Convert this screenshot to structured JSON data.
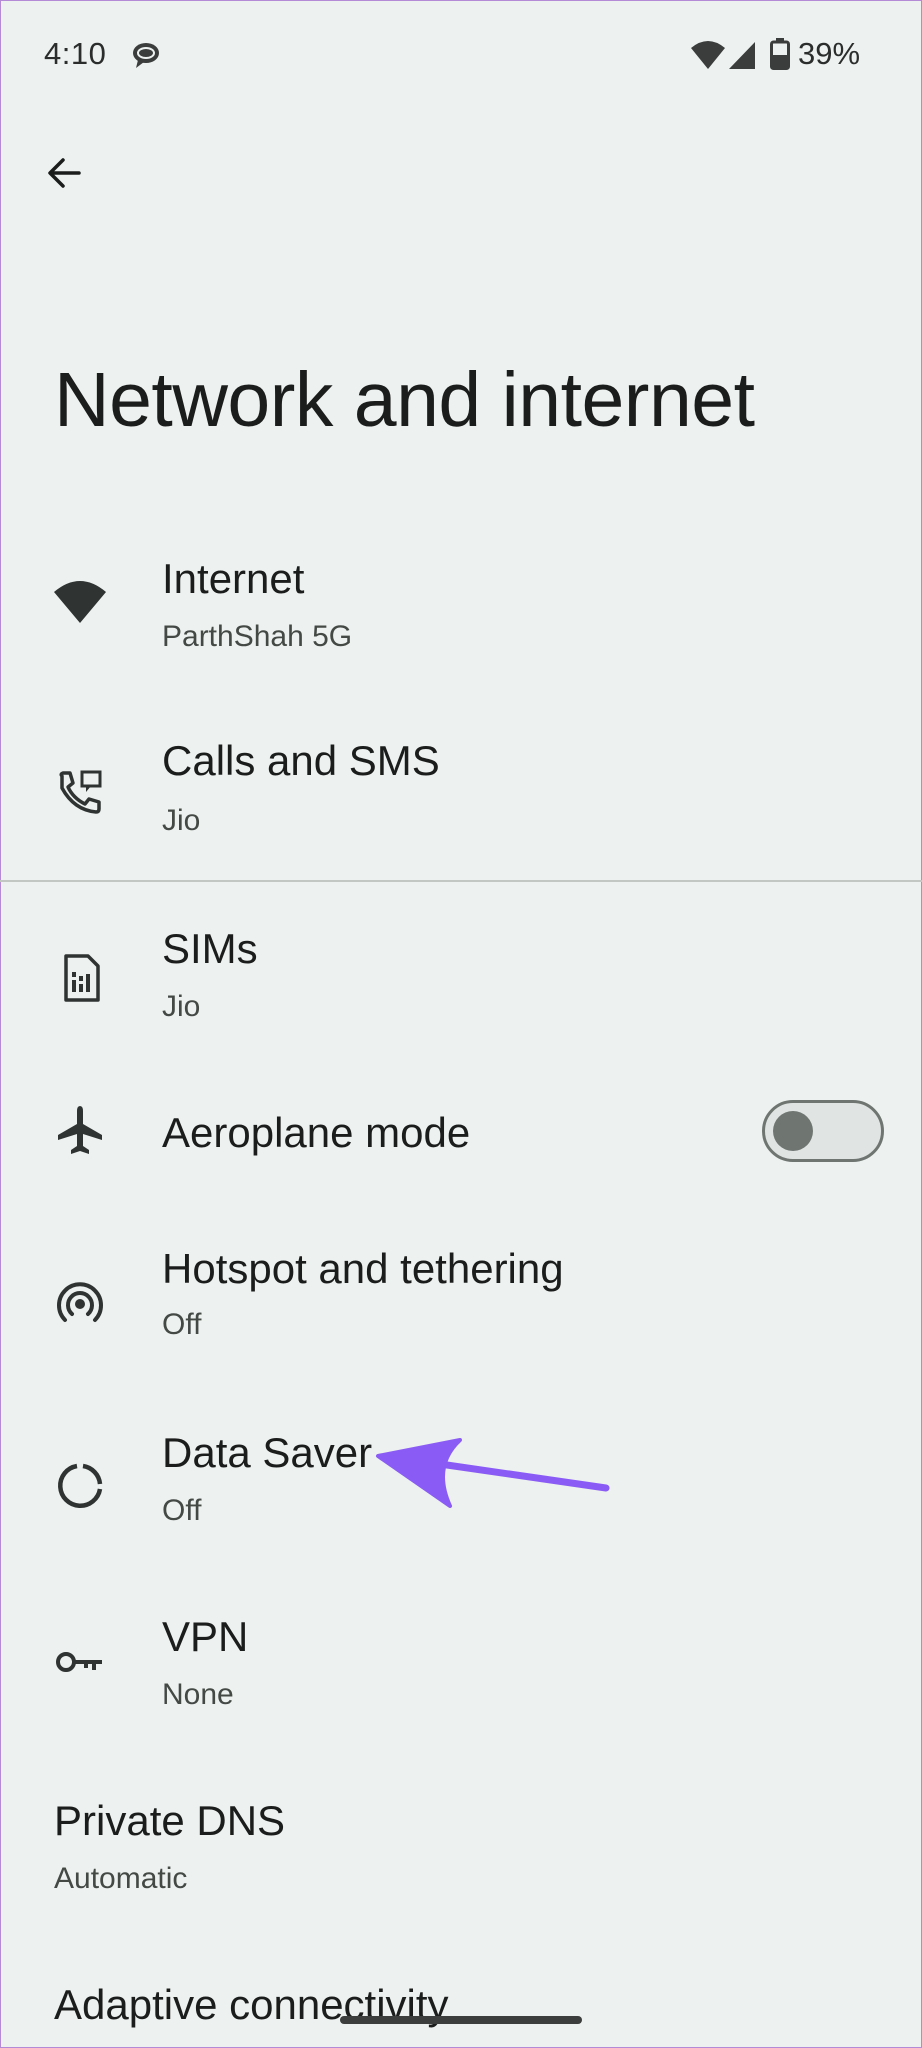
{
  "status_bar": {
    "time": "4:10",
    "battery": "39%",
    "icons": [
      "message-bubble-icon",
      "wifi-icon",
      "signal-icon",
      "battery-icon"
    ]
  },
  "header": {
    "back_icon": "arrow-back-icon",
    "title": "Network and internet"
  },
  "items": [
    {
      "title": "Internet",
      "subtitle": "ParthShah 5G",
      "icon": "wifi-icon"
    },
    {
      "title": "Calls and SMS",
      "subtitle": "Jio",
      "icon": "phone-sms-icon"
    },
    {
      "title": "SIMs",
      "subtitle": "Jio",
      "icon": "sim-card-icon"
    },
    {
      "title": "Aeroplane mode",
      "icon": "airplane-icon",
      "toggle_on": false
    },
    {
      "title": "Hotspot and tethering",
      "subtitle": "Off",
      "icon": "hotspot-icon"
    },
    {
      "title": "Data Saver",
      "subtitle": "Off",
      "icon": "data-saver-icon"
    },
    {
      "title": "VPN",
      "subtitle": "None",
      "icon": "key-icon"
    },
    {
      "title": "Private DNS",
      "subtitle": "Automatic"
    },
    {
      "title": "Adaptive connectivity"
    }
  ],
  "colors": {
    "background": "#edf1ef",
    "text_primary": "#1b1d1c",
    "text_secondary": "#444946",
    "annotation_arrow": "#8a5cf5"
  }
}
